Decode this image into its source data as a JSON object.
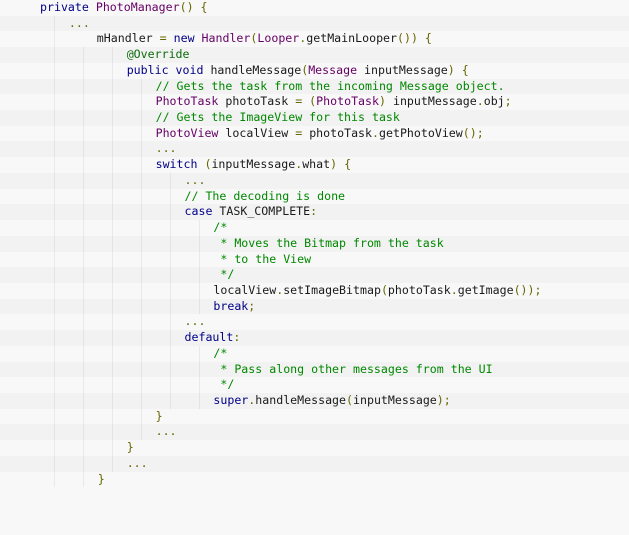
{
  "code": {
    "language": "java",
    "lines": [
      {
        "indent": 1,
        "tokens": [
          {
            "t": "keyword",
            "v": "private "
          },
          {
            "t": "type",
            "v": "PhotoManager"
          },
          {
            "t": "punct",
            "v": "() {"
          }
        ]
      },
      {
        "indent": 2,
        "tokens": [
          {
            "t": "ellipsis",
            "v": "..."
          }
        ]
      },
      {
        "indent": 2,
        "tokens": [
          {
            "t": "plain",
            "v": "    mHandler "
          },
          {
            "t": "punct",
            "v": "= "
          },
          {
            "t": "keyword",
            "v": "new "
          },
          {
            "t": "type",
            "v": "Handler"
          },
          {
            "t": "punct",
            "v": "("
          },
          {
            "t": "type",
            "v": "Looper"
          },
          {
            "t": "punct",
            "v": "."
          },
          {
            "t": "plain",
            "v": "getMainLooper"
          },
          {
            "t": "punct",
            "v": "()) {"
          }
        ]
      },
      {
        "indent": 4,
        "tokens": [
          {
            "t": "annotation",
            "v": "@Override"
          }
        ]
      },
      {
        "indent": 4,
        "tokens": [
          {
            "t": "keyword",
            "v": "public void "
          },
          {
            "t": "plain",
            "v": "handleMessage"
          },
          {
            "t": "punct",
            "v": "("
          },
          {
            "t": "type",
            "v": "Message "
          },
          {
            "t": "plain",
            "v": "inputMessage"
          },
          {
            "t": "punct",
            "v": ") {"
          }
        ]
      },
      {
        "indent": 5,
        "tokens": [
          {
            "t": "comment",
            "v": "// Gets the task from the incoming Message object."
          }
        ]
      },
      {
        "indent": 5,
        "tokens": [
          {
            "t": "type",
            "v": "PhotoTask "
          },
          {
            "t": "plain",
            "v": "photoTask "
          },
          {
            "t": "punct",
            "v": "= ("
          },
          {
            "t": "type",
            "v": "PhotoTask"
          },
          {
            "t": "punct",
            "v": ") "
          },
          {
            "t": "plain",
            "v": "inputMessage"
          },
          {
            "t": "punct",
            "v": "."
          },
          {
            "t": "plain",
            "v": "obj"
          },
          {
            "t": "punct",
            "v": ";"
          }
        ]
      },
      {
        "indent": 5,
        "tokens": [
          {
            "t": "comment",
            "v": "// Gets the ImageView for this task"
          }
        ]
      },
      {
        "indent": 5,
        "tokens": [
          {
            "t": "type",
            "v": "PhotoView "
          },
          {
            "t": "plain",
            "v": "localView "
          },
          {
            "t": "punct",
            "v": "= "
          },
          {
            "t": "plain",
            "v": "photoTask"
          },
          {
            "t": "punct",
            "v": "."
          },
          {
            "t": "plain",
            "v": "getPhotoView"
          },
          {
            "t": "punct",
            "v": "();"
          }
        ]
      },
      {
        "indent": 5,
        "tokens": [
          {
            "t": "ellipsis",
            "v": "..."
          }
        ]
      },
      {
        "indent": 5,
        "tokens": [
          {
            "t": "keyword",
            "v": "switch "
          },
          {
            "t": "punct",
            "v": "("
          },
          {
            "t": "plain",
            "v": "inputMessage"
          },
          {
            "t": "punct",
            "v": "."
          },
          {
            "t": "plain",
            "v": "what"
          },
          {
            "t": "punct",
            "v": ") {"
          }
        ]
      },
      {
        "indent": 6,
        "tokens": [
          {
            "t": "ellipsis",
            "v": "..."
          }
        ]
      },
      {
        "indent": 6,
        "tokens": [
          {
            "t": "comment",
            "v": "// The decoding is done"
          }
        ]
      },
      {
        "indent": 6,
        "tokens": [
          {
            "t": "keyword",
            "v": "case "
          },
          {
            "t": "plain",
            "v": "TASK_COMPLETE"
          },
          {
            "t": "punct",
            "v": ":"
          }
        ]
      },
      {
        "indent": 7,
        "tokens": [
          {
            "t": "comment",
            "v": "/*"
          }
        ]
      },
      {
        "indent": 7,
        "tokens": [
          {
            "t": "comment",
            "v": " * Moves the Bitmap from the task"
          }
        ]
      },
      {
        "indent": 7,
        "tokens": [
          {
            "t": "comment",
            "v": " * to the View"
          }
        ]
      },
      {
        "indent": 7,
        "tokens": [
          {
            "t": "comment",
            "v": " */"
          }
        ]
      },
      {
        "indent": 7,
        "tokens": [
          {
            "t": "plain",
            "v": "localView"
          },
          {
            "t": "punct",
            "v": "."
          },
          {
            "t": "plain",
            "v": "setImageBitmap"
          },
          {
            "t": "punct",
            "v": "("
          },
          {
            "t": "plain",
            "v": "photoTask"
          },
          {
            "t": "punct",
            "v": "."
          },
          {
            "t": "plain",
            "v": "getImage"
          },
          {
            "t": "punct",
            "v": "());"
          }
        ]
      },
      {
        "indent": 7,
        "tokens": [
          {
            "t": "keyword",
            "v": "break"
          },
          {
            "t": "punct",
            "v": ";"
          }
        ]
      },
      {
        "indent": 6,
        "tokens": [
          {
            "t": "ellipsis",
            "v": "..."
          }
        ]
      },
      {
        "indent": 6,
        "tokens": [
          {
            "t": "keyword",
            "v": "default"
          },
          {
            "t": "punct",
            "v": ":"
          }
        ]
      },
      {
        "indent": 7,
        "tokens": [
          {
            "t": "comment",
            "v": "/*"
          }
        ]
      },
      {
        "indent": 7,
        "tokens": [
          {
            "t": "comment",
            "v": " * Pass along other messages from the UI"
          }
        ]
      },
      {
        "indent": 7,
        "tokens": [
          {
            "t": "comment",
            "v": " */"
          }
        ]
      },
      {
        "indent": 7,
        "tokens": [
          {
            "t": "keyword",
            "v": "super"
          },
          {
            "t": "punct",
            "v": "."
          },
          {
            "t": "plain",
            "v": "handleMessage"
          },
          {
            "t": "punct",
            "v": "("
          },
          {
            "t": "plain",
            "v": "inputMessage"
          },
          {
            "t": "punct",
            "v": ");"
          }
        ]
      },
      {
        "indent": 5,
        "tokens": [
          {
            "t": "punct",
            "v": "}"
          }
        ]
      },
      {
        "indent": 5,
        "tokens": [
          {
            "t": "ellipsis",
            "v": "..."
          }
        ]
      },
      {
        "indent": 4,
        "tokens": [
          {
            "t": "punct",
            "v": "}"
          }
        ]
      },
      {
        "indent": 4,
        "tokens": [
          {
            "t": "ellipsis",
            "v": "..."
          }
        ]
      },
      {
        "indent": 3,
        "tokens": [
          {
            "t": "punct",
            "v": "}"
          }
        ]
      }
    ]
  },
  "colors": {
    "background": "#f8f8f8",
    "alt_row": "#f2f2f2",
    "keyword": "#000088",
    "type": "#660066",
    "comment": "#008800",
    "annotation": "#0b6d0b",
    "punct": "#666600",
    "plain": "#1a1a1a"
  }
}
